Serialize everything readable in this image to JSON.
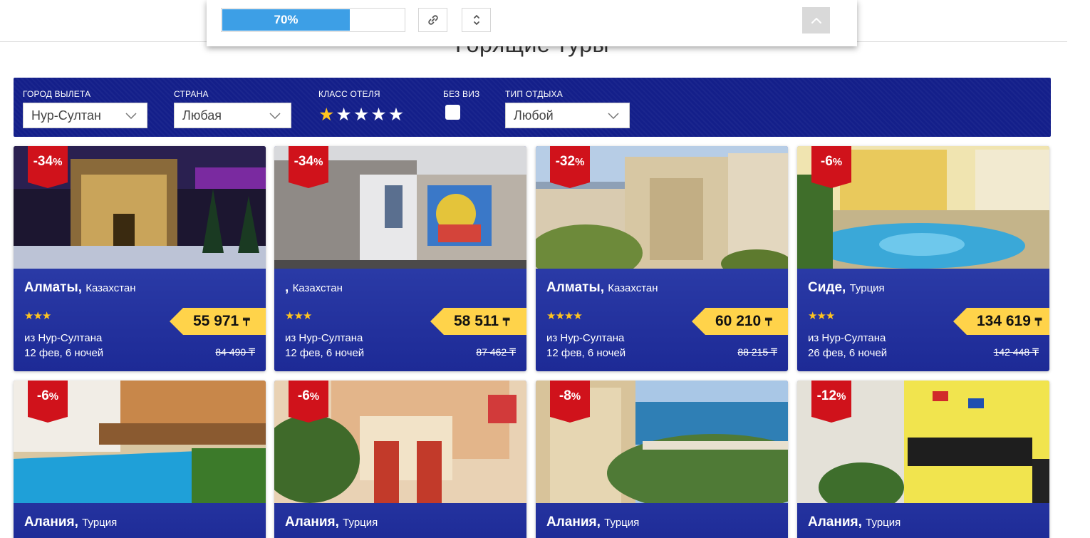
{
  "page": {
    "title": "Горящие туры"
  },
  "toolbar": {
    "progress_percent": 70,
    "progress_label": "70%",
    "link_icon": "link-icon",
    "sort_icon": "sort-icon",
    "up_icon": "chevron-up-icon"
  },
  "filters": {
    "departure_label": "ГОРОД ВЫЛЕТА",
    "departure_value": "Нур-Султан",
    "country_label": "СТРАНА",
    "country_value": "Любая",
    "hotel_class_label": "КЛАСС ОТЕЛЯ",
    "hotel_class_selected": 1,
    "hotel_class_max": 5,
    "visa_label": "БЕЗ ВИЗ",
    "rest_type_label": "ТИП ОТДЫХА",
    "rest_type_value": "Любой"
  },
  "colors": {
    "filter_bg": "#141f8a",
    "card_bg": "#2a3aa6",
    "discount_bg": "#d0121b",
    "price_bg": "#ffd34a",
    "star": "#ffc420",
    "progress": "#3d9fe6"
  },
  "cards": [
    {
      "discount": "-34",
      "pct": "%",
      "city": "Алматы",
      "country": "Казахстан",
      "stars": "★★★",
      "price": "55 971",
      "currency": "₸",
      "from": "из Нур-Султана",
      "date": "12 фев, 6 ночей",
      "old_price": "84 490 ₸"
    },
    {
      "discount": "-34",
      "pct": "%",
      "city": "",
      "country": "Казахстан",
      "stars": "★★★",
      "price": "58 511",
      "currency": "₸",
      "from": "из Нур-Султана",
      "date": "12 фев, 6 ночей",
      "old_price": "87 462 ₸"
    },
    {
      "discount": "-32",
      "pct": "%",
      "city": "Алматы",
      "country": "Казахстан",
      "stars": "★★★★",
      "price": "60 210",
      "currency": "₸",
      "from": "из Нур-Султана",
      "date": "12 фев, 6 ночей",
      "old_price": "88 215 ₸"
    },
    {
      "discount": "-6",
      "pct": "%",
      "city": "Сиде",
      "country": "Турция",
      "stars": "★★★",
      "price": "134 619",
      "currency": "₸",
      "from": "из Нур-Султана",
      "date": "26 фев, 6 ночей",
      "old_price": "142 448 ₸"
    },
    {
      "discount": "-6",
      "pct": "%",
      "city": "Алания",
      "country": "Турция"
    },
    {
      "discount": "-6",
      "pct": "%",
      "city": "Алания",
      "country": "Турция"
    },
    {
      "discount": "-8",
      "pct": "%",
      "city": "Алания",
      "country": "Турция"
    },
    {
      "discount": "-12",
      "pct": "%",
      "city": "Алания",
      "country": "Турция"
    }
  ]
}
